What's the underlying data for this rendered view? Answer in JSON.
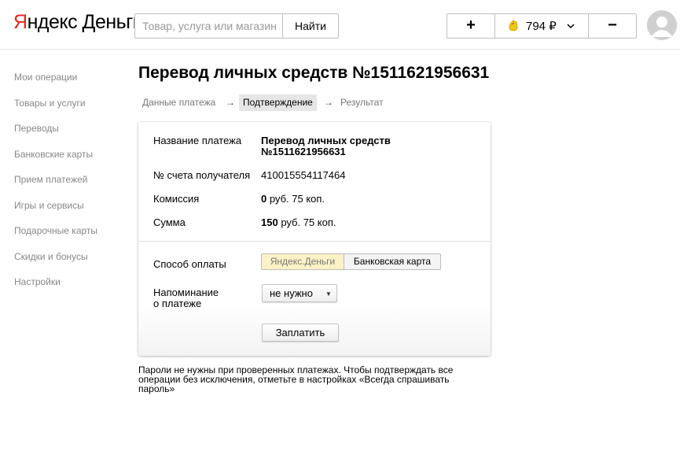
{
  "header": {
    "logo": {
      "part1": "Я",
      "part2": "ндекс",
      "part3": " Деньги"
    },
    "search": {
      "placeholder": "Товар, услуга или магазин",
      "value": "",
      "button_label": "Найти"
    },
    "wallet": {
      "plus_label": "+",
      "balance": "794 ₽",
      "minus_label": "−"
    }
  },
  "sidebar": {
    "items": [
      {
        "label": "Мои операции"
      },
      {
        "label": "Товары и услуги"
      },
      {
        "label": "Переводы"
      },
      {
        "label": "Банковские карты"
      },
      {
        "label": "Прием платежей"
      },
      {
        "label": "Игры и сервисы"
      },
      {
        "label": "Подарочные карты"
      },
      {
        "label": "Скидки и бонусы"
      },
      {
        "label": "Настройки"
      }
    ]
  },
  "main": {
    "title": "Перевод личных средств №1511621956631",
    "steps": {
      "step1": "Данные платежа",
      "arrow": "→",
      "step2": "Подтверждение",
      "step3": "Результат"
    },
    "details": {
      "name_label": "Название платежа",
      "name_value_line1": "Перевод личных средств",
      "name_value_line2": "№1511621956631",
      "account_label": "№ счета получателя",
      "account_value": "410015554117464",
      "commission_label": "Комиссия",
      "commission_amount": "0",
      "commission_rest": " руб. 75 коп.",
      "sum_label": "Сумма",
      "sum_amount": "150",
      "sum_rest": " руб. 75 коп."
    },
    "payment": {
      "method_label": "Способ оплаты",
      "method_option1": "Яндекс.Деньги",
      "method_option2": "Банковская карта",
      "reminder_label_line1": "Напоминание",
      "reminder_label_line2": "о платеже",
      "reminder_value": "не нужно",
      "pay_button": "Заплатить"
    },
    "note_line1": "Пароли не нужны при проверенных платежах. Чтобы подтверждать все",
    "note_line2": "операции без исключения, отметьте в настройках «Всегда спрашивать",
    "note_line3": "пароль»"
  },
  "colors": {
    "logo_red": "#e52620",
    "selected_option_bg": "#fdf2c5",
    "coin_yellow": "#f5c518"
  }
}
